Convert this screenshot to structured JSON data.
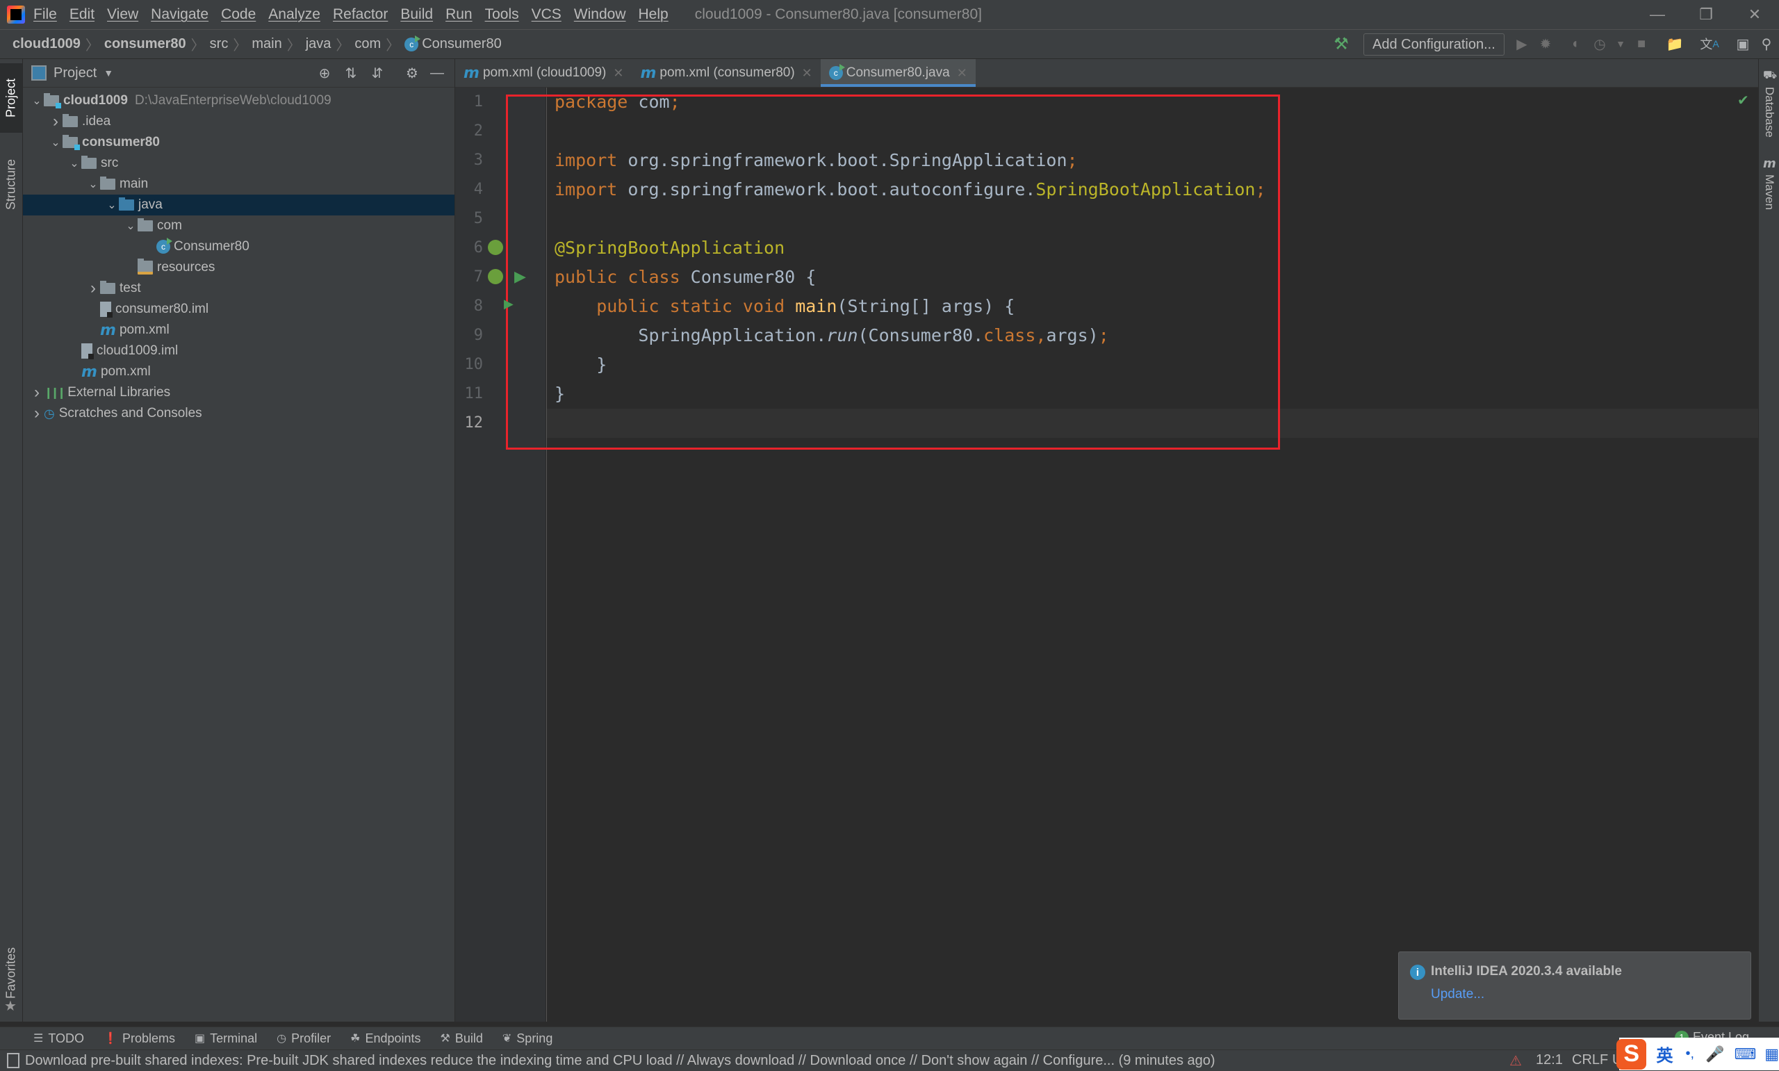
{
  "window": {
    "title": "cloud1009 - Consumer80.java [consumer80]",
    "minimize_icon": "minimize-icon",
    "restore_icon": "restore-icon",
    "close_icon": "close-icon"
  },
  "menu": [
    "File",
    "Edit",
    "View",
    "Navigate",
    "Code",
    "Analyze",
    "Refactor",
    "Build",
    "Run",
    "Tools",
    "VCS",
    "Window",
    "Help"
  ],
  "breadcrumb": [
    "cloud1009",
    "consumer80",
    "src",
    "main",
    "java",
    "com",
    "Consumer80"
  ],
  "toolbar": {
    "add_configuration": "Add Configuration...",
    "icons": [
      "build-hammer-icon",
      "run-icon",
      "debug-icon",
      "coverage-icon",
      "profile-icon",
      "dropdown-icon",
      "stop-icon",
      "project-structure-icon",
      "translate-icon",
      "terminal-run-icon",
      "search-icon"
    ]
  },
  "left_strip": {
    "project": "Project",
    "structure": "Structure",
    "favorites": "Favorites"
  },
  "right_strip": {
    "database": "Database",
    "maven": "Maven"
  },
  "project_panel": {
    "title": "Project",
    "tree": [
      {
        "label": "cloud1009",
        "extra": "D:\\JavaEnterpriseWeb\\cloud1009",
        "bold": true,
        "depth": 0,
        "chevron": "down",
        "icon": "module-folder"
      },
      {
        "label": ".idea",
        "depth": 1,
        "chevron": "right",
        "icon": "folder"
      },
      {
        "label": "consumer80",
        "bold": true,
        "depth": 1,
        "chevron": "down",
        "icon": "module-folder"
      },
      {
        "label": "src",
        "depth": 2,
        "chevron": "down",
        "icon": "folder"
      },
      {
        "label": "main",
        "depth": 3,
        "chevron": "down",
        "icon": "folder"
      },
      {
        "label": "java",
        "depth": 4,
        "chevron": "down",
        "icon": "source-folder",
        "selected": true
      },
      {
        "label": "com",
        "depth": 5,
        "chevron": "down",
        "icon": "package"
      },
      {
        "label": "Consumer80",
        "depth": 6,
        "icon": "spring-class"
      },
      {
        "label": "resources",
        "depth": 5,
        "icon": "resources-folder"
      },
      {
        "label": "test",
        "depth": 3,
        "chevron": "right",
        "icon": "folder"
      },
      {
        "label": "consumer80.iml",
        "depth": 3,
        "icon": "iml-file"
      },
      {
        "label": "pom.xml",
        "depth": 3,
        "icon": "maven-file"
      },
      {
        "label": "cloud1009.iml",
        "depth": 2,
        "icon": "iml-file"
      },
      {
        "label": "pom.xml",
        "depth": 2,
        "icon": "maven-file"
      },
      {
        "label": "External Libraries",
        "depth": 0,
        "chevron": "right",
        "icon": "libraries"
      },
      {
        "label": "Scratches and Consoles",
        "depth": 0,
        "chevron": "right",
        "icon": "scratches"
      }
    ]
  },
  "tabs": [
    {
      "label": "pom.xml (cloud1009)",
      "icon": "maven-file",
      "active": false
    },
    {
      "label": "pom.xml (consumer80)",
      "icon": "maven-file",
      "active": false
    },
    {
      "label": "Consumer80.java",
      "icon": "spring-class",
      "active": true
    }
  ],
  "editor": {
    "current_line": 12,
    "lines": [
      [
        {
          "t": "package ",
          "c": "kw"
        },
        {
          "t": "com",
          "c": ""
        },
        {
          "t": ";",
          "c": "kw"
        }
      ],
      [],
      [
        {
          "t": "import ",
          "c": "kw"
        },
        {
          "t": "org.springframework.boot.SpringApplication",
          "c": ""
        },
        {
          "t": ";",
          "c": "kw"
        }
      ],
      [
        {
          "t": "import ",
          "c": "kw"
        },
        {
          "t": "org.springframework.boot.autoconfigure.",
          "c": ""
        },
        {
          "t": "SpringBootApplication",
          "c": "ann"
        },
        {
          "t": ";",
          "c": "kw"
        }
      ],
      [],
      [
        {
          "t": "@SpringBootApplication",
          "c": "ann"
        }
      ],
      [
        {
          "t": "public class ",
          "c": "kw"
        },
        {
          "t": "Consumer80 {",
          "c": ""
        }
      ],
      [
        {
          "t": "    public static void ",
          "c": "kw"
        },
        {
          "t": "main",
          "c": "fn"
        },
        {
          "t": "(String[] args) {",
          "c": ""
        }
      ],
      [
        {
          "t": "        SpringApplication.",
          "c": ""
        },
        {
          "t": "run",
          "c": "it"
        },
        {
          "t": "(Consumer80.",
          "c": ""
        },
        {
          "t": "class",
          "c": "kw"
        },
        {
          "t": ",",
          "c": "kw"
        },
        {
          "t": "args)",
          "c": ""
        },
        {
          "t": ";",
          "c": "kw"
        }
      ],
      [
        {
          "t": "    }",
          "c": ""
        }
      ],
      [
        {
          "t": "}",
          "c": ""
        }
      ],
      []
    ]
  },
  "notification": {
    "title": "IntelliJ IDEA 2020.3.4 available",
    "action": "Update..."
  },
  "bottom_tools": [
    {
      "label": "TODO",
      "icon": "todo-icon"
    },
    {
      "label": "Problems",
      "icon": "problems-icon"
    },
    {
      "label": "Terminal",
      "icon": "terminal-icon"
    },
    {
      "label": "Profiler",
      "icon": "profiler-icon"
    },
    {
      "label": "Endpoints",
      "icon": "endpoints-icon"
    },
    {
      "label": "Build",
      "icon": "build-icon"
    },
    {
      "label": "Spring",
      "icon": "spring-icon"
    }
  ],
  "event_log": {
    "label": "Event Log",
    "count": "1"
  },
  "status": {
    "message": "Download pre-built shared indexes: Pre-built JDK shared indexes reduce the indexing time and CPU load // Always download // Download once // Don't show again // Configure... (9 minutes ago)",
    "position": "12:1",
    "line_ending": "CRLF",
    "encoding_partial": "U"
  },
  "ime": {
    "lang": "英",
    "punct": "•,"
  },
  "colors": {
    "accent": "#4a88c7",
    "red_box": "#e8232b",
    "keyword": "#cc7832",
    "annotation": "#bbb529",
    "method": "#ffc66d",
    "text": "#a9b7c6",
    "link": "#589df6"
  }
}
